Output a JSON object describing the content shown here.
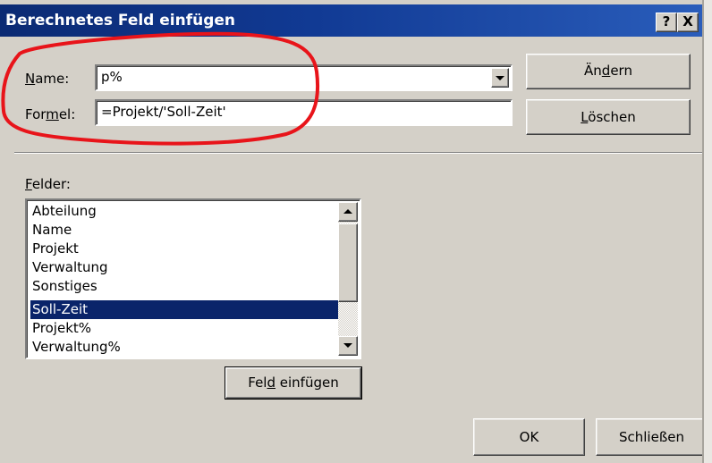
{
  "dialog": {
    "title": "Berechnetes Feld einfügen",
    "help_button": "?",
    "close_button": "X"
  },
  "name_field": {
    "label_mnemonic": "N",
    "label_rest": "ame:",
    "value": "p%"
  },
  "formula_field": {
    "label_start": "For",
    "label_mnemonic": "m",
    "label_rest": "el:",
    "value": "=Projekt/'Soll-Zeit'"
  },
  "buttons": {
    "change": {
      "before": "Än",
      "mnemonic": "d",
      "after": "ern"
    },
    "delete": {
      "before": "",
      "mnemonic": "L",
      "after": "öschen"
    },
    "insert_field": {
      "before": "Fel",
      "mnemonic": "d",
      "after": " einfügen"
    },
    "ok": "OK",
    "close": "Schließen"
  },
  "fields": {
    "label_mnemonic": "F",
    "label_rest": "elder:",
    "items": [
      "Abteilung",
      "Name",
      "Projekt",
      "Verwaltung",
      "Sonstiges",
      "Soll-Zeit",
      "Projekt%",
      "Verwaltung%"
    ],
    "selected": "Soll-Zeit"
  },
  "icons": {
    "dropdown": "chevron-down-icon",
    "scroll_up": "arrow-up-icon",
    "scroll_down": "arrow-down-icon"
  },
  "colors": {
    "titlebar_start": "#0b2a73",
    "titlebar_end": "#2a5dbb",
    "selection": "#0a246a",
    "annotation": "#e8141a",
    "dialog_face": "#d4d0c8"
  }
}
